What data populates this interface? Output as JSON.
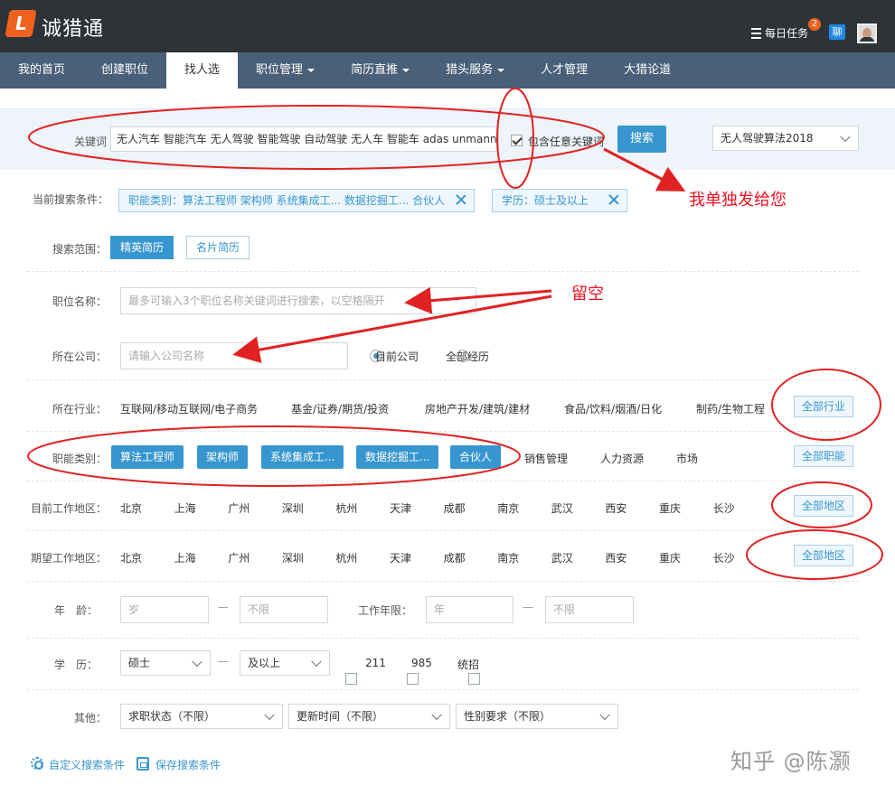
{
  "header": {
    "logo_mark": "L",
    "logo_text": "诚猎通",
    "daily_task": "每日任务",
    "task_badge": "2",
    "chat_label": "聊"
  },
  "nav": [
    {
      "label": "我的首页"
    },
    {
      "label": "创建职位"
    },
    {
      "label": "找人选",
      "active": true
    },
    {
      "label": "职位管理",
      "dropdown": true
    },
    {
      "label": "简历直推",
      "dropdown": true
    },
    {
      "label": "猎头服务",
      "dropdown": true
    },
    {
      "label": "人才管理"
    },
    {
      "label": "大猎论道"
    }
  ],
  "search": {
    "keyword_label": "关键词",
    "keyword_value": "无人汽车 智能汽车 无人驾驶 智能驾驶 自动驾驶 无人车 智能车 adas unmann",
    "include_any_label": "包含任意关键词",
    "include_any_checked": true,
    "search_button": "搜索",
    "saved_search": "无人驾驶算法2018"
  },
  "conditions": {
    "label": "当前搜索条件：",
    "tags": [
      "职能类别：算法工程师 架构师 系统集成工... 数据挖掘工... 合伙人",
      "学历：硕士及以上"
    ]
  },
  "scope": {
    "label": "搜索范围：",
    "options": [
      "精英简历",
      "名片简历"
    ],
    "selected": "精英简历"
  },
  "job_title": {
    "label": "职位名称：",
    "placeholder": "最多可输入3个职位名称关键词进行搜索，以空格隔开"
  },
  "company": {
    "label": "所在公司：",
    "placeholder": "请输入公司名称",
    "radio_current": "目前公司",
    "radio_all": "全部经历",
    "selected": "目前公司"
  },
  "industry": {
    "label": "所在行业：",
    "options": [
      "互联网/移动互联网/电子商务",
      "基金/证券/期货/投资",
      "房地产开发/建筑/建材",
      "食品/饮料/烟酒/日化",
      "制药/生物工程"
    ],
    "all_button": "全部行业"
  },
  "function": {
    "label": "职能类别：",
    "selected": [
      "算法工程师",
      "架构师",
      "系统集成工...",
      "数据挖掘工...",
      "合伙人"
    ],
    "options": [
      "销售管理",
      "人力资源",
      "市场"
    ],
    "all_button": "全部职能"
  },
  "current_location": {
    "label": "目前工作地区：",
    "cities": [
      "北京",
      "上海",
      "广州",
      "深圳",
      "杭州",
      "天津",
      "成都",
      "南京",
      "武汉",
      "西安",
      "重庆",
      "长沙"
    ],
    "all_button": "全部地区"
  },
  "expected_location": {
    "label": "期望工作地区：",
    "cities": [
      "北京",
      "上海",
      "广州",
      "深圳",
      "杭州",
      "天津",
      "成都",
      "南京",
      "武汉",
      "西安",
      "重庆",
      "长沙"
    ],
    "all_button": "全部地区"
  },
  "age": {
    "label": "年　龄：",
    "from_placeholder": "岁",
    "to_placeholder": "不限",
    "dash": "—"
  },
  "years": {
    "label": "工作年限：",
    "from_placeholder": "年",
    "to_placeholder": "不限",
    "dash": "—"
  },
  "education": {
    "label": "学　历：",
    "from_value": "硕士",
    "to_value": "及以上",
    "dash": "—",
    "checks": [
      "211",
      "985",
      "统招"
    ]
  },
  "other": {
    "label": "其他：",
    "selects": [
      "求职状态（不限）",
      "更新时间（不限）",
      "性别要求（不限）"
    ]
  },
  "footer": {
    "custom_conditions": "自定义搜索条件",
    "save_conditions": "保存搜索条件",
    "watermark": "知乎 @陈灏"
  },
  "annotations": {
    "send_separately": "我单独发给您",
    "leave_blank": "留空",
    "color": "#e12222"
  }
}
